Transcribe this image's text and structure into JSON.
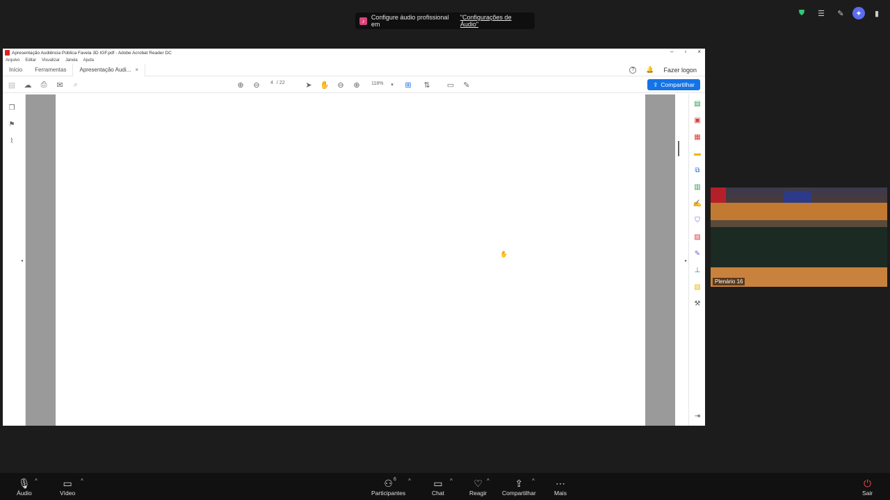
{
  "notification": {
    "text": "Configure áudio profissional em",
    "link": "\"Configurações de Áudio\""
  },
  "acrobat": {
    "title": "Apresentação Audiência Pública Favela 3D IGF.pdf - Adobe Acrobat Reader DC",
    "menu": [
      "Arquivo",
      "Editar",
      "Visualizar",
      "Janela",
      "Ajuda"
    ],
    "tabs": {
      "home": "Início",
      "tools": "Ferramentas",
      "doc": "Apresentação Audi..."
    },
    "login": "Fazer logon",
    "page_current": "4",
    "page_total": "/ 22",
    "zoom": "118%",
    "share_label": "Compartilhar",
    "colors": {
      "share": "#1473e6"
    }
  },
  "video": {
    "label": "Plenário 16"
  },
  "zoom_bar": {
    "audio": "Áudio",
    "video": "Vídeo",
    "participants": "Participantes",
    "participants_count": "6",
    "chat": "Chat",
    "react": "Reagir",
    "share": "Compartilhar",
    "more": "Mais",
    "leave": "Sair"
  }
}
